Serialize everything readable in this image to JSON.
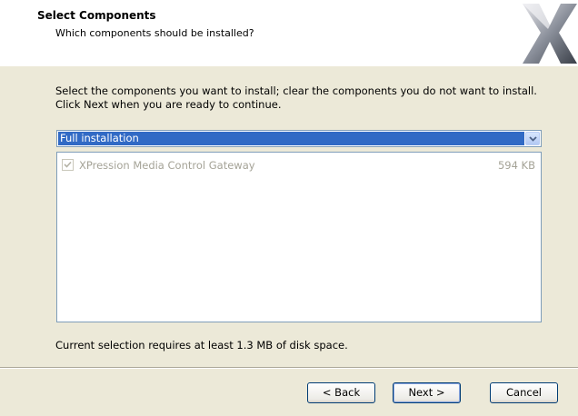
{
  "header": {
    "title": "Select Components",
    "subtitle": "Which components should be installed?",
    "logo_icon": "x-logo"
  },
  "instructions": "Select the components you want to install; clear the components you do not want to install. Click Next when you are ready to continue.",
  "install_type": {
    "selected": "Full installation"
  },
  "components": [
    {
      "name": "XPression Media Control Gateway",
      "size": "594 KB",
      "checked": true,
      "enabled": false
    }
  ],
  "disk_space": "Current selection requires at least 1.3 MB of disk space.",
  "buttons": {
    "back": "< Back",
    "next": "Next >",
    "cancel": "Cancel"
  },
  "colors": {
    "selection": "#316ac5",
    "dialog_bg": "#ece9d8"
  }
}
